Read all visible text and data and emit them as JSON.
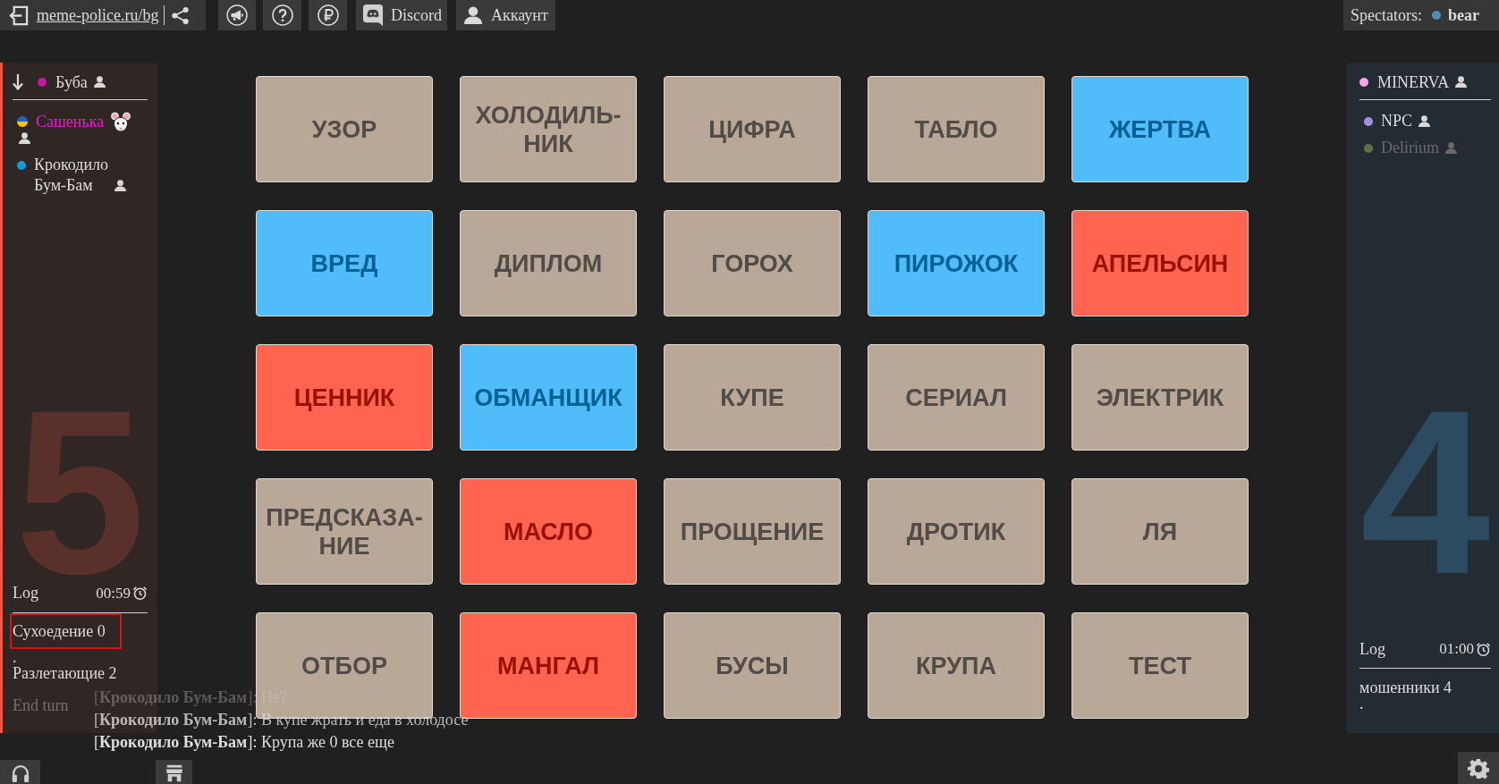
{
  "topbar": {
    "link": "meme-police.ru/bg",
    "buttons": [
      {
        "kind": "megaphone"
      },
      {
        "kind": "help"
      },
      {
        "kind": "ruble"
      },
      {
        "kind": "discord",
        "label": "Discord"
      },
      {
        "kind": "account",
        "label": "Аккаунт"
      }
    ]
  },
  "spectators": {
    "label": "Spectators:",
    "people": [
      {
        "name": "bear",
        "color": "#4b8fb5"
      }
    ]
  },
  "teams": [
    {
      "kind": "red",
      "turn": true,
      "leader": {
        "name": "Буба",
        "color": "#c21aa8"
      },
      "players": [
        {
          "name": "Сашенька",
          "kind": "flag",
          "highlighted": true,
          "badge": true,
          "online": true
        },
        {
          "name": "Крокодило Бум-Бам",
          "kind": "dot",
          "color": "#0b9de3",
          "highlighted": false,
          "badge": false,
          "online": true
        }
      ],
      "score": "5",
      "log_label": "Log",
      "timer": "00:59",
      "log": [
        {
          "text": "Сухоедение 0",
          "highlighted": true
        },
        {
          "text": ".",
          "highlighted": false
        },
        {
          "text": "Разлетающие 2",
          "highlighted": false
        }
      ],
      "end_turn": {
        "label": "End turn",
        "disabled": true
      }
    },
    {
      "kind": "blue",
      "turn": false,
      "leader": {
        "name": "MINERVA",
        "color": "#f2a6f0"
      },
      "players": [
        {
          "name": "NPC",
          "kind": "dot",
          "color": "#a58ee0",
          "highlighted": false,
          "badge": false,
          "online": true
        },
        {
          "name": "Delirium",
          "kind": "dot",
          "color": "#5d7442",
          "highlighted": false,
          "badge": false,
          "online": false
        }
      ],
      "score": "4",
      "log_label": "Log",
      "timer": "01:00",
      "log": [
        {
          "text": "мошенники 4",
          "highlighted": false
        },
        {
          "text": ".",
          "highlighted": false
        }
      ]
    }
  ],
  "cards": [
    {
      "word": "УЗОР",
      "color": "#b9a797"
    },
    {
      "word": "ХОЛОДИЛЬ-НИК",
      "color": "#b9a797"
    },
    {
      "word": "ЦИФРА",
      "color": "#b9a797"
    },
    {
      "word": "ТАБЛО",
      "color": "#b9a797"
    },
    {
      "word": "ЖЕРТВА",
      "color": "#50bcfa"
    },
    {
      "word": "ВРЕД",
      "color": "#50bcfa"
    },
    {
      "word": "ДИПЛОМ",
      "color": "#b9a797"
    },
    {
      "word": "ГОРОХ",
      "color": "#b9a797"
    },
    {
      "word": "ПИРОЖОК",
      "color": "#50bcfa"
    },
    {
      "word": "АПЕЛЬСИН",
      "color": "#ff6450"
    },
    {
      "word": "ЦЕННИК",
      "color": "#ff6450"
    },
    {
      "word": "ОБМАНЩИК",
      "color": "#50bcfa"
    },
    {
      "word": "КУПЕ",
      "color": "#b9a797"
    },
    {
      "word": "СЕРИАЛ",
      "color": "#b9a797"
    },
    {
      "word": "ЭЛЕКТРИК",
      "color": "#b9a797"
    },
    {
      "word": "ПРЕДСКАЗА-НИЕ",
      "color": "#b9a797"
    },
    {
      "word": "МАСЛО",
      "color": "#ff6450"
    },
    {
      "word": "ПРОЩЕНИЕ",
      "color": "#b9a797"
    },
    {
      "word": "ДРОТИК",
      "color": "#b9a797"
    },
    {
      "word": "ЛЯ",
      "color": "#b9a797"
    },
    {
      "word": "ОТБОР",
      "color": "#b9a797"
    },
    {
      "word": "МАНГАЛ",
      "color": "#ff6450"
    },
    {
      "word": "БУСЫ",
      "color": "#b9a797"
    },
    {
      "word": "КРУПА",
      "color": "#b9a797"
    },
    {
      "word": "ТЕСТ",
      "color": "#b9a797"
    }
  ],
  "chat": [
    {
      "text": "[**Крокодило Бум-Бам**]: Не?",
      "kind": "faint"
    },
    {
      "text": "[**Крокодило Бум-Бам**]: В купе жрать и еда в холодосе",
      "kind": "dim"
    },
    {
      "text": "[**Крокодило Бум-Бам**]: Крупа же 0 все еще",
      "kind": "full"
    }
  ],
  "bottom_buttons": [
    {
      "kind": "headphones"
    },
    {
      "kind": "store"
    },
    {
      "kind": "settings"
    }
  ]
}
